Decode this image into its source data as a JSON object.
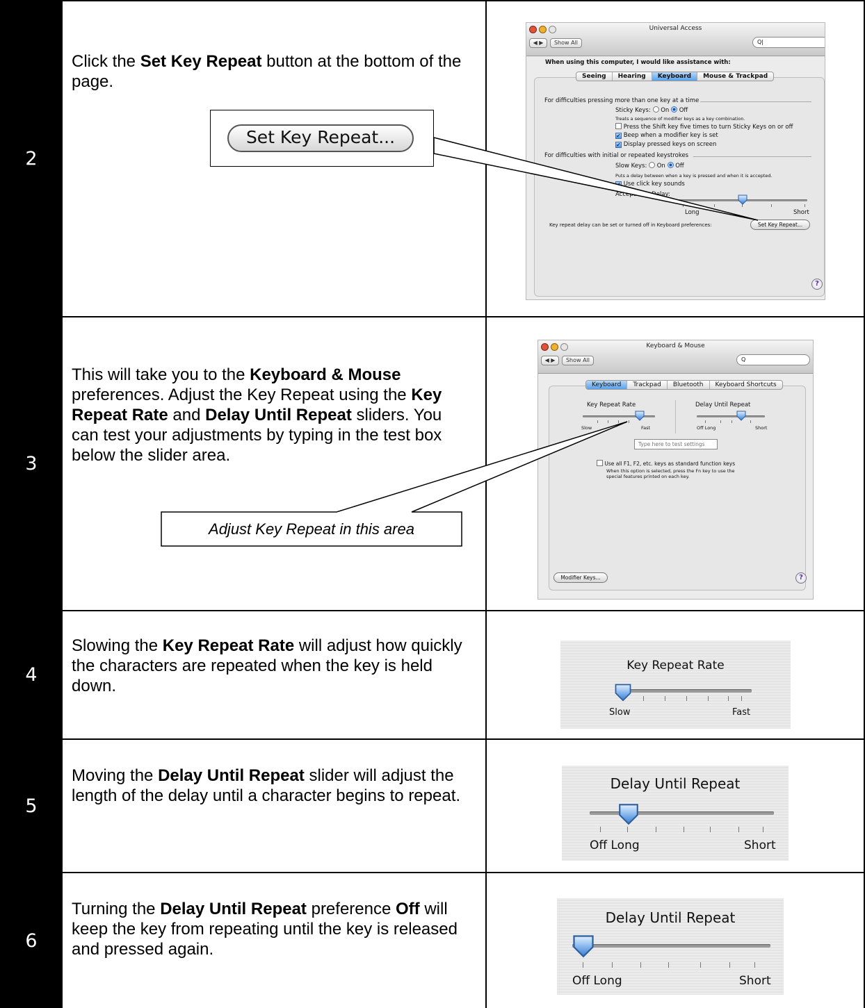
{
  "rows": [
    {
      "number": "2",
      "text_parts": [
        "Click the ",
        "Set Key Repeat",
        " button at the bottom of the page."
      ],
      "callout_button_label": "Set Key Repeat...",
      "screenshot": {
        "window_title": "Universal Access",
        "show_all": "Show All",
        "search_value": "",
        "assistance_prompt": "When using this computer, I would like assistance with:",
        "tabs": [
          "Seeing",
          "Hearing",
          "Keyboard",
          "Mouse & Trackpad"
        ],
        "selected_tab": "Keyboard",
        "section1_header": "For difficulties pressing more than one key at a time",
        "sticky_keys_label": "Sticky Keys:",
        "on_label": "On",
        "off_label": "Off",
        "sticky_desc": "Treats a sequence of modifier keys as a key combination.",
        "opt_shift": "Press the Shift key five times to turn Sticky Keys on or off",
        "opt_beep": "Beep when a modifier key is set",
        "opt_display": "Display pressed keys on screen",
        "section2_header": "For difficulties with initial or repeated keystrokes",
        "slow_keys_label": "Slow Keys:",
        "slow_desc": "Puts a delay between when a key is pressed and when it is accepted.",
        "opt_click_sounds": "Use click key sounds",
        "acceptance_delay_label": "Acceptance Delay:",
        "long_label": "Long",
        "short_label": "Short",
        "key_repeat_note": "Key repeat delay can be set or turned off in Keyboard preferences:",
        "set_key_repeat_button": "Set Key Repeat...",
        "help_glyph": "?",
        "sticky_keys": "Off",
        "slow_keys": "Off",
        "shift_five_times_checked": false,
        "beep_checked": true,
        "display_keys_checked": true,
        "click_sounds_checked": true
      }
    },
    {
      "number": "3",
      "text_parts": [
        "This will take you to the ",
        "Keyboard & Mouse",
        " preferences.  Adjust the Key Repeat using the ",
        "Key Repeat Rate",
        " and ",
        "Delay Until Repeat",
        " sliders.  You can test your adjustments by typing in the test box below the slider area."
      ],
      "callout_text": "Adjust Key Repeat in this area",
      "screenshot": {
        "window_title": "Keyboard & Mouse",
        "show_all": "Show All",
        "tabs": [
          "Keyboard",
          "Trackpad",
          "Bluetooth",
          "Keyboard Shortcuts"
        ],
        "selected_tab": "Keyboard",
        "key_repeat_rate_label": "Key Repeat Rate",
        "delay_until_repeat_label": "Delay Until Repeat",
        "slow_label": "Slow",
        "fast_label": "Fast",
        "off_label": "Off",
        "long_label": "Long",
        "short_label": "Short",
        "test_box_placeholder": "Type here to test settings",
        "fkeys_option": "Use all F1, F2, etc. keys as standard function keys",
        "fkeys_desc_1": "When this option is selected, press the Fn key to use the",
        "fkeys_desc_2": "special features printed on each key.",
        "modifier_keys_button": "Modifier Keys...",
        "help_glyph": "?",
        "fkeys_checked": false
      }
    },
    {
      "number": "4",
      "text_parts": [
        "Slowing the ",
        "Key Repeat Rate",
        " will adjust how quickly the characters are repeated when the key is held down."
      ],
      "screenshot": {
        "label": "Key Repeat Rate",
        "min_label": "Slow",
        "max_label": "Fast",
        "slider_position": 0.0
      }
    },
    {
      "number": "5",
      "text_parts": [
        "Moving the ",
        "Delay Until Repeat",
        " slider will adjust the length of the delay until a character begins to repeat."
      ],
      "screenshot": {
        "label": "Delay Until Repeat",
        "off_label": "Off",
        "min_label": "Long",
        "max_label": "Short",
        "slider_position": 0.2
      }
    },
    {
      "number": "6",
      "text_parts": [
        "Turning the ",
        "Delay Until Repeat",
        " preference ",
        "Off",
        " will keep the key from repeating until the key is released and pressed again."
      ],
      "screenshot": {
        "label": "Delay Until Repeat",
        "off_label": "Off",
        "min_label": "Long",
        "max_label": "Short",
        "slider_position": 0.0
      }
    }
  ],
  "colors": {
    "number_cell_bg": "#000000",
    "selected_tab": "#5aa2ea",
    "slider_thumb": "#6fa8e8",
    "window_bg": "#ececec"
  }
}
